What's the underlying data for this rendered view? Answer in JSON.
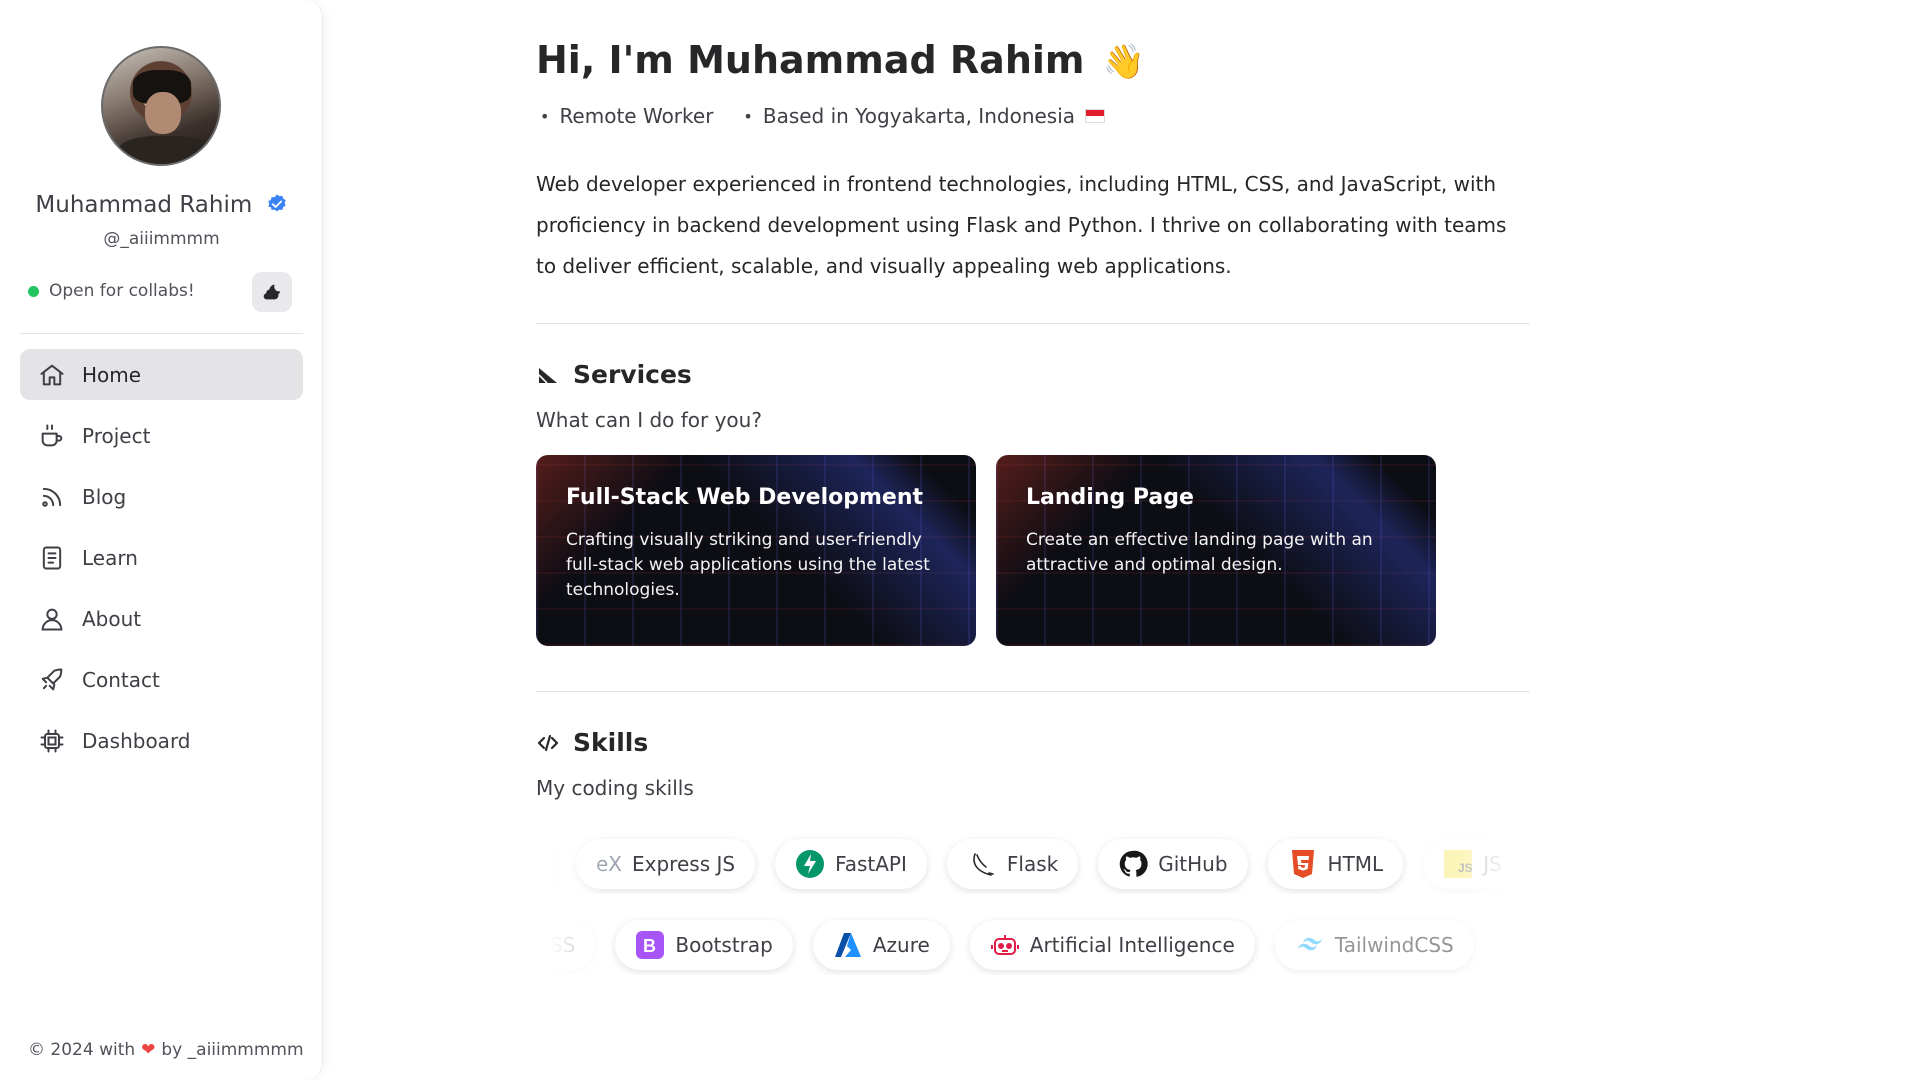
{
  "sidebar": {
    "name": "Muhammad Rahim",
    "handle": "@_aiiimmmm",
    "status": "Open for collabs!",
    "nav": [
      {
        "label": "Home",
        "icon": "home-icon"
      },
      {
        "label": "Project",
        "icon": "coffee-icon"
      },
      {
        "label": "Blog",
        "icon": "rss-icon"
      },
      {
        "label": "Learn",
        "icon": "notebook-icon"
      },
      {
        "label": "About",
        "icon": "user-icon"
      },
      {
        "label": "Contact",
        "icon": "rocket-icon"
      },
      {
        "label": "Dashboard",
        "icon": "cpu-icon"
      }
    ],
    "footer_prefix": "© 2024 with",
    "footer_suffix": "by _aiiimmmmm"
  },
  "hero": {
    "title": "Hi, I'm Muhammad Rahim",
    "wave": "👋",
    "meta_1": "Remote Worker",
    "meta_2": "Based in Yogyakarta, Indonesia",
    "bio": "Web developer experienced in frontend technologies, including HTML, CSS, and JavaScript, with proficiency in backend development using Flask and Python. I thrive on collaborating with teams to deliver efficient, scalable, and visually appealing web applications."
  },
  "services": {
    "title": "Services",
    "subtitle": "What can I do for you?",
    "cards": [
      {
        "title": "Full-Stack Web Development",
        "desc": "Crafting visually striking and user-friendly full-stack web applications using the latest technologies."
      },
      {
        "title": "Landing Page",
        "desc": "Create an effective landing page with an attractive and optimal design."
      }
    ]
  },
  "skills": {
    "title": "Skills",
    "subtitle": "My coding skills",
    "row1": [
      "Express JS",
      "FastAPI",
      "Flask",
      "GitHub",
      "HTML",
      "JS"
    ],
    "row2": [
      "CSS",
      "Bootstrap",
      "Azure",
      "Artificial Intelligence",
      "TailwindCSS"
    ]
  },
  "colors": {
    "accent_green": "#22c55e",
    "verified_blue": "#3b82f6",
    "heart_red": "#ef4444",
    "fastapi_teal": "#059669",
    "html_orange": "#e44d26",
    "bootstrap_purple": "#7952b3",
    "azure_blue": "#0078d4",
    "tailwind_cyan": "#38bdf8"
  }
}
